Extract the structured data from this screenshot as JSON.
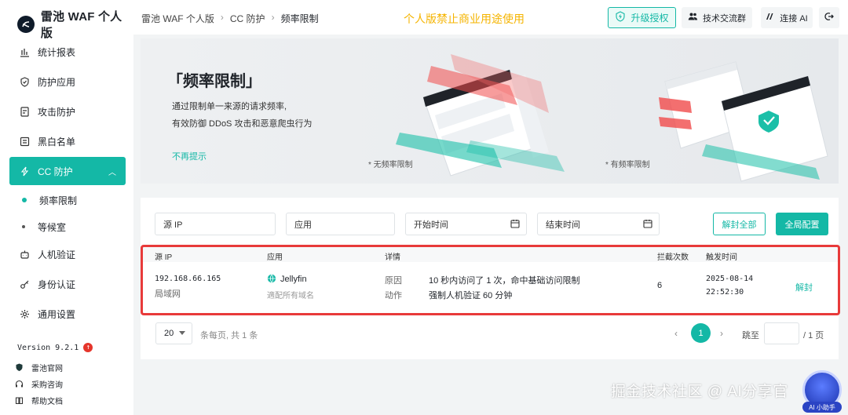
{
  "brand": {
    "name": "雷池 WAF 个人版"
  },
  "sidebar": {
    "items": [
      {
        "label": "统计报表",
        "icon": "bar-chart-icon"
      },
      {
        "label": "防护应用",
        "icon": "shield-icon"
      },
      {
        "label": "攻击防护",
        "icon": "document-icon"
      },
      {
        "label": "黑白名单",
        "icon": "list-icon"
      },
      {
        "label": "CC 防护",
        "icon": "lightning-icon",
        "active": true
      },
      {
        "label": "人机验证",
        "icon": "robot-icon"
      },
      {
        "label": "身份认证",
        "icon": "key-icon"
      },
      {
        "label": "通用设置",
        "icon": "gear-icon"
      }
    ],
    "subitems": [
      {
        "label": "频率限制",
        "active": true
      },
      {
        "label": "等候室"
      }
    ],
    "version": "Version 9.2.1",
    "footer_links": [
      {
        "label": "雷池官网",
        "icon": "shield-icon"
      },
      {
        "label": "采购咨询",
        "icon": "headset-icon"
      },
      {
        "label": "帮助文档",
        "icon": "book-icon"
      }
    ]
  },
  "topbar": {
    "breadcrumb": [
      "雷池 WAF 个人版",
      "CC 防护",
      "频率限制"
    ],
    "notice": "个人版禁止商业用途使用",
    "upgrade_label": "升级授权",
    "group_label": "技术交流群",
    "ai_label": "连接 AI"
  },
  "banner": {
    "title": "「频率限制」",
    "desc_line1": "通过限制单一来源的请求频率,",
    "desc_line2": "有效防御 DDoS 攻击和恶意爬虫行为",
    "dismiss": "不再提示",
    "caption_without": "* 无频率限制",
    "caption_with": "* 有频率限制"
  },
  "filters": {
    "source_ip_placeholder": "源 IP",
    "app_placeholder": "应用",
    "start_placeholder": "开始时间",
    "end_placeholder": "结束时间",
    "unban_all_label": "解封全部",
    "global_config_label": "全局配置"
  },
  "table": {
    "headers": {
      "source_ip": "源 IP",
      "app": "应用",
      "detail": "详情",
      "count": "拦截次数",
      "time": "触发时间"
    },
    "rows": [
      {
        "ip": "192.168.66.165",
        "network": "局域网",
        "app": "Jellyfin",
        "app_scope": "適配所有域名",
        "reason_label": "原因",
        "reason_prefix": "10 秒内访问了 1 次，命中基础访问限制",
        "action_label": "动作",
        "action_text": "强制人机验证 60 分钟",
        "count": "6",
        "date": "2025-08-14",
        "time": "22:52:30",
        "unban_label": "解封"
      }
    ]
  },
  "pagination": {
    "page_size": "20",
    "info": "条每页, 共 1 条",
    "current_page": "1",
    "jump_label": "跳至",
    "total_pages": "/ 1 页"
  },
  "overlay": {
    "watermark": "掘金技术社区 @ AI分享官",
    "assistant_label": "AI 小助手"
  },
  "colors": {
    "accent": "#14b8a6",
    "notice": "#f5b400",
    "highlight_box": "#e83a3a"
  }
}
